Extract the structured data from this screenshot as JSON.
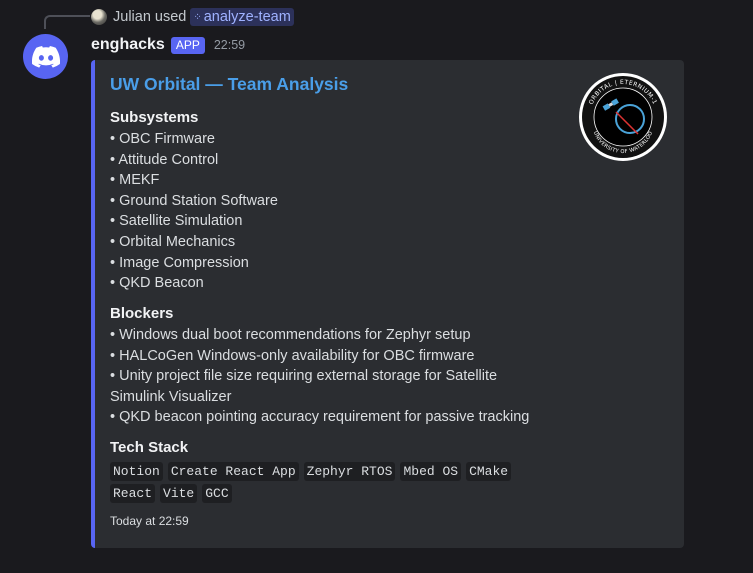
{
  "reply": {
    "user": "Julian",
    "action": "used",
    "command": "analyze-team"
  },
  "message": {
    "username": "enghacks",
    "badge": "APP",
    "timestamp": "22:59"
  },
  "embed": {
    "title": "UW Orbital — Team Analysis",
    "accent_color": "#5865f2",
    "thumbnail_text_top": "ORBITAL | ETERNIUM-1",
    "thumbnail_text_bottom": "UNIVERSITY OF WATERLOO",
    "sections": [
      {
        "title": "Subsystems",
        "items": [
          "OBC Firmware",
          "Attitude Control",
          "MEKF",
          "Ground Station Software",
          "Satellite Simulation",
          "Orbital Mechanics",
          "Image Compression",
          "QKD Beacon"
        ]
      },
      {
        "title": "Blockers",
        "items": [
          "Windows dual boot recommendations for Zephyr setup",
          "HALCoGen Windows-only availability for OBC firmware",
          "Unity project file size requiring external storage for Satellite Simulink Visualizer",
          "QKD beacon pointing accuracy requirement for passive tracking"
        ]
      }
    ],
    "tech_stack_title": "Tech Stack",
    "tech_stack": [
      "Notion",
      "Create React App",
      "Zephyr RTOS",
      "Mbed OS",
      "CMake",
      "React",
      "Vite",
      "GCC"
    ],
    "footer": "Today at 22:59"
  }
}
